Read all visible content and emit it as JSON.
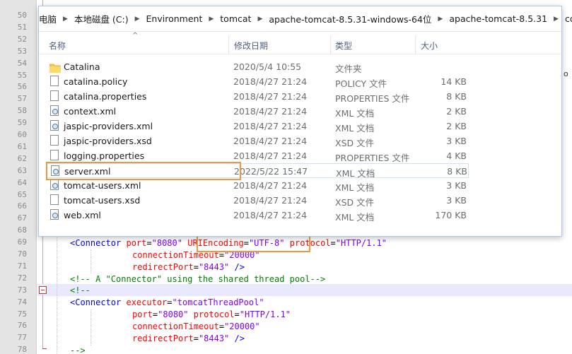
{
  "explorer": {
    "breadcrumb": [
      "电脑",
      "本地磁盘 (C:)",
      "Environment",
      "tomcat",
      "apache-tomcat-8.5.31-windows-64位",
      "apache-tomcat-8.5.31",
      "conf"
    ],
    "columns": {
      "name": "名称",
      "date": "修改日期",
      "type": "类型",
      "size": "大小"
    },
    "files": [
      {
        "name": "Catalina",
        "date": "2020/5/4 10:55",
        "type": "文件夹",
        "size": "",
        "icon": "folder-icon"
      },
      {
        "name": "catalina.policy",
        "date": "2018/4/27 21:24",
        "type": "POLICY 文件",
        "size": "14 KB",
        "icon": "file-icon"
      },
      {
        "name": "catalina.properties",
        "date": "2018/4/27 21:24",
        "type": "PROPERTIES 文件",
        "size": "8 KB",
        "icon": "file-icon"
      },
      {
        "name": "context.xml",
        "date": "2018/4/27 21:24",
        "type": "XML 文档",
        "size": "2 KB",
        "icon": "xml-file-icon"
      },
      {
        "name": "jaspic-providers.xml",
        "date": "2018/4/27 21:24",
        "type": "XML 文档",
        "size": "2 KB",
        "icon": "xml-file-icon"
      },
      {
        "name": "jaspic-providers.xsd",
        "date": "2018/4/27 21:24",
        "type": "XSD 文件",
        "size": "3 KB",
        "icon": "file-icon"
      },
      {
        "name": "logging.properties",
        "date": "2018/4/27 21:24",
        "type": "PROPERTIES 文件",
        "size": "4 KB",
        "icon": "file-icon"
      },
      {
        "name": "server.xml",
        "date": "2022/5/22 15:47",
        "type": "XML 文档",
        "size": "8 KB",
        "icon": "xml-file-icon"
      },
      {
        "name": "tomcat-users.xml",
        "date": "2018/4/27 21:24",
        "type": "XML 文档",
        "size": "3 KB",
        "icon": "xml-file-icon"
      },
      {
        "name": "tomcat-users.xsd",
        "date": "2018/4/27 21:24",
        "type": "XSD 文件",
        "size": "3 KB",
        "icon": "file-icon"
      },
      {
        "name": "web.xml",
        "date": "2018/4/27 21:24",
        "type": "XML 文档",
        "size": "170 KB",
        "icon": "xml-file-icon"
      }
    ]
  },
  "editor": {
    "line_numbers": [
      "50",
      "51",
      "52",
      "53",
      "54",
      "55",
      "56",
      "57",
      "58",
      "59",
      "60",
      "61",
      "62",
      "63",
      "64",
      "65",
      "66",
      "67",
      "68",
      "69",
      "70",
      "71",
      "72",
      "73",
      "74",
      "75",
      "76",
      "77",
      "78"
    ],
    "code": {
      "l69": {
        "tag": "<Connector",
        "a1": "port",
        "v1": "\"8080\"",
        "a2": "URIEncoding",
        "v2": "\"UTF-8\"",
        "a3": "protocol",
        "v3": "\"HTTP/1.1\""
      },
      "l70": {
        "a": "connectionTimeout",
        "v": "\"20000\""
      },
      "l71": {
        "a": "redirectPort",
        "v": "\"8443\"",
        "end": " />"
      },
      "l72": {
        "comment": "<!-- A \"Connector\" using the shared thread pool-->"
      },
      "l73": {
        "comment": "<!--"
      },
      "l74": {
        "tag": "<Connector",
        "a": "executor",
        "v": "\"tomcatThreadPool\""
      },
      "l75": {
        "a1": "port",
        "v1": "\"8080\"",
        "a2": "protocol",
        "v2": "\"HTTP/1.1\""
      },
      "l76": {
        "a": "connectionTimeout",
        "v": "\"20000\""
      },
      "l77": {
        "a": "redirectPort",
        "v": "\"8443\"",
        "end": " />"
      },
      "l78": {
        "comment": "-->"
      }
    },
    "edge_char": "o",
    "colors": {
      "highlight": "#f0963c",
      "tag": "#0000ff",
      "attr": "#ff0000",
      "value": "#8000ff",
      "comment": "#008000"
    }
  }
}
